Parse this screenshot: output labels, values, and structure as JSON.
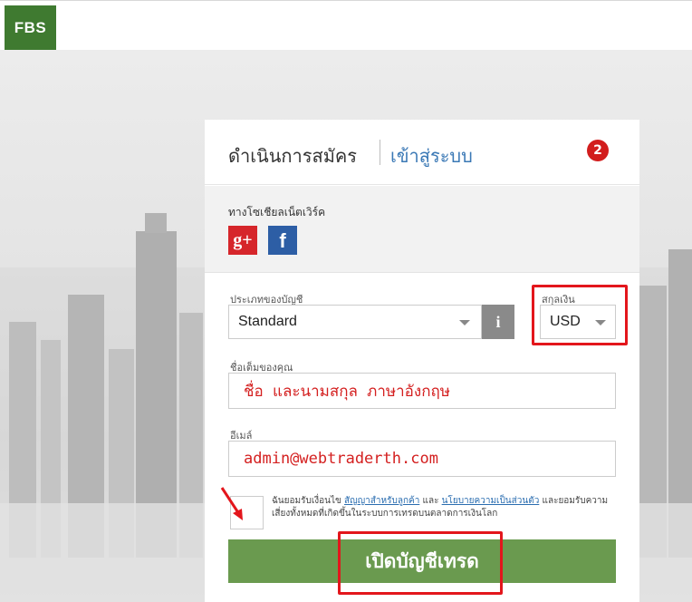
{
  "brand": {
    "logo_text": "FBS"
  },
  "header": {
    "tab_register": "ดำเนินการสมัคร",
    "tab_login": "เข้าสู่ระบบ",
    "step_badge": "2"
  },
  "social": {
    "label": "ทางโซเชียลเน็ตเวิร์ค",
    "google_plus_glyph": "g+",
    "facebook_glyph": "f"
  },
  "form": {
    "account_type_label": "ประเภทของบัญชี",
    "account_type_value": "Standard",
    "info_glyph": "i",
    "currency_label": "สกุลเงิน",
    "currency_value": "USD",
    "name_label": "ชื่อเต็มของคุณ",
    "name_value": "ชื่อ และนามสกุล ภาษาอังกฤษ",
    "email_label": "อีเมล์",
    "email_value": "admin@webtraderth.com",
    "terms_prefix": "ฉันยอมรับเงื่อนไข",
    "terms_link1": "สัญญาสำหรับลูกค้า",
    "terms_and": "และ",
    "terms_link2": "นโยบายความเป็นส่วนตัว",
    "terms_suffix": "และยอมรับความเสี่ยงทั้งหมดที่เกิดขึ้นในระบบการเทรดบนตลาดการเงินโลก",
    "submit_label": "เปิดบัญชีเทรด"
  },
  "colors": {
    "brand_green": "#3f7a30",
    "button_green": "#6a9a4f",
    "link_blue": "#3a78b5",
    "highlight_red": "#e3161c"
  }
}
